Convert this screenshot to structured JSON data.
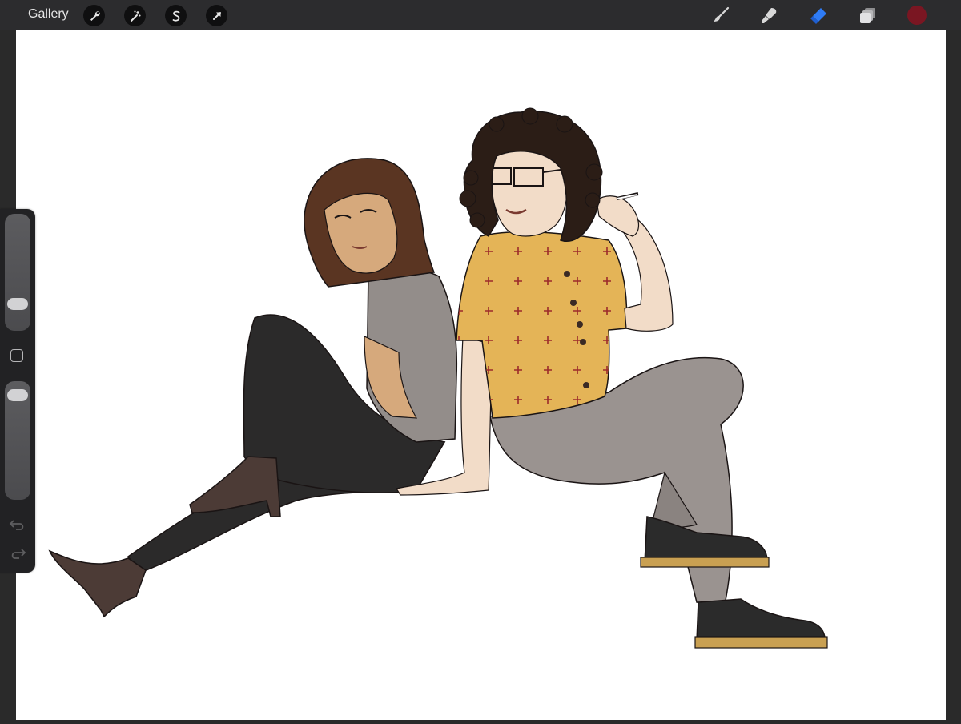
{
  "app": {
    "gallery_label": "Gallery",
    "left_tools": [
      "wrench-icon",
      "magic-wand-icon",
      "selection-icon",
      "transform-arrow-icon"
    ],
    "right_tools": [
      "brush-icon",
      "smudge-icon",
      "eraser-icon",
      "layers-icon"
    ],
    "active_tool": "eraser",
    "active_tool_color": "#2f7cf6",
    "current_color": "#7a1622"
  },
  "sidebar": {
    "brush_size_level": 0.2,
    "opacity_level": 0.05,
    "undo_icon": "undo-icon",
    "redo_icon": "redo-icon",
    "modify_button_icon": "square-icon"
  },
  "artwork": {
    "subject": "illustration",
    "colors": {
      "shirt_yellow": "#e4b457",
      "pattern_red": "#9b2a2a",
      "pants_grey": "#9a9390",
      "tshirt_grey": "#938d8a",
      "leggings_black": "#2a2a2a",
      "hair_brown": "#5a3522",
      "hair_dark": "#2b1d16",
      "skin_tan": "#d6a97c",
      "skin_light": "#f2dcc8",
      "boot_brown": "#4c3b36",
      "boot_black": "#2b2b2b",
      "sole_tan": "#c9a052"
    }
  }
}
